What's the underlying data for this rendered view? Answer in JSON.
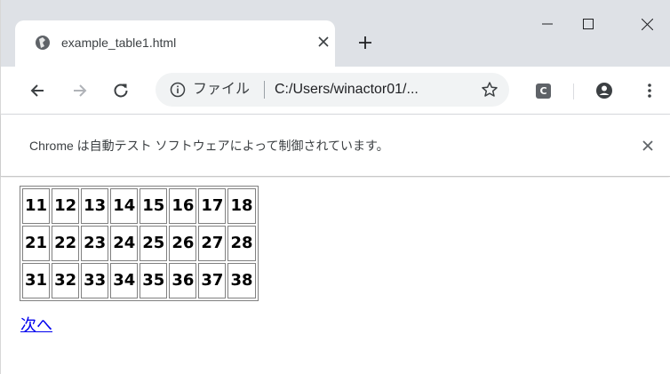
{
  "browser": {
    "tab": {
      "title": "example_table1.html"
    },
    "omnibox": {
      "scheme_label": "ファイル",
      "url": "C:/Users/winactor01/..."
    },
    "extension_icon_letter": "C",
    "infobar": {
      "message": "Chrome は自動テスト ソフトウェアによって制御されています。"
    }
  },
  "page": {
    "table": {
      "rows": [
        [
          "11",
          "12",
          "13",
          "14",
          "15",
          "16",
          "17",
          "18"
        ],
        [
          "21",
          "22",
          "23",
          "24",
          "25",
          "26",
          "27",
          "28"
        ],
        [
          "31",
          "32",
          "33",
          "34",
          "35",
          "36",
          "37",
          "38"
        ]
      ]
    },
    "next_link": "次へ"
  }
}
